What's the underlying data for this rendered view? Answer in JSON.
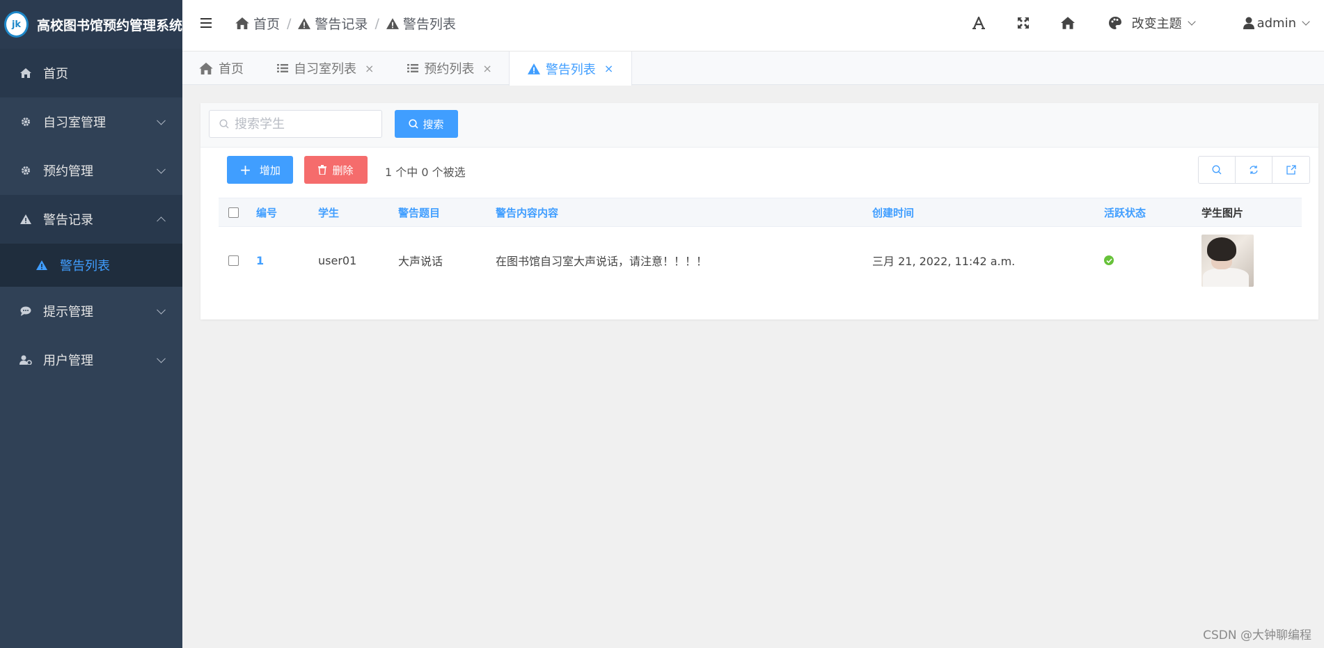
{
  "app": {
    "title": "高校图书馆预约管理系统",
    "logo_text": "jk"
  },
  "sidebar": {
    "items": [
      {
        "label": "首页",
        "icon": "home-icon"
      },
      {
        "label": "自习室管理",
        "icon": "gear-icon"
      },
      {
        "label": "预约管理",
        "icon": "gear-icon"
      },
      {
        "label": "警告记录",
        "icon": "warning-icon"
      },
      {
        "label": "警告列表",
        "icon": "warning-icon",
        "active": true
      },
      {
        "label": "提示管理",
        "icon": "comment-icon"
      },
      {
        "label": "用户管理",
        "icon": "user-gear-icon"
      }
    ]
  },
  "breadcrumb": [
    {
      "label": "首页"
    },
    {
      "label": "警告记录"
    },
    {
      "label": "警告列表"
    }
  ],
  "breadcrumb_sep": "/",
  "header": {
    "theme_label": "改变主题",
    "user_label": "admin"
  },
  "tabs": [
    {
      "label": "首页"
    },
    {
      "label": "自习室列表",
      "close": "×"
    },
    {
      "label": "预约列表",
      "close": "×"
    },
    {
      "label": "警告列表",
      "close": "×",
      "active": true
    }
  ],
  "search": {
    "placeholder": "搜索学生",
    "button_label": "搜索"
  },
  "toolbar": {
    "add_label": "增加",
    "add_symbol": "+",
    "delete_label": "删除",
    "selection_info": "1 个中 0 个被选"
  },
  "table": {
    "headers": [
      "编号",
      "学生",
      "警告题目",
      "警告内容内容",
      "创建时间",
      "活跃状态",
      "学生图片"
    ],
    "rows": [
      {
        "id": "1",
        "student": "user01",
        "title": "大声说话",
        "content": "在图书馆自习室大声说话，请注意！！！！",
        "created": "三月 21, 2022, 11:42 a.m.",
        "active": true
      }
    ]
  },
  "watermark": "CSDN @大钟聊编程",
  "colors": {
    "sidebar_bg": "#304156",
    "primary": "#409eff",
    "danger": "#f56c6c",
    "success": "#67c23a"
  }
}
